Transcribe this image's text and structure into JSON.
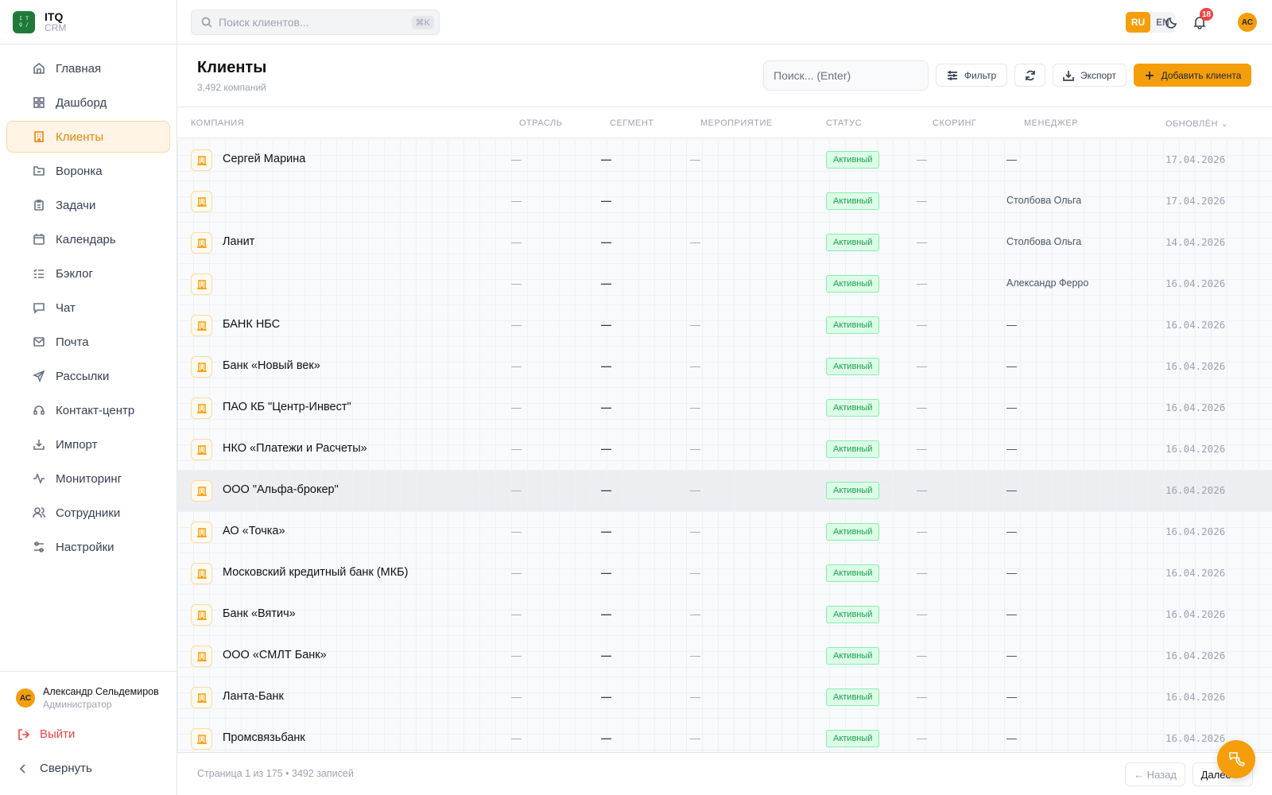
{
  "brand": {
    "name": "ITQ",
    "sub": "CRM",
    "logo_glyphs": [
      "I",
      "T",
      "Q",
      "/"
    ]
  },
  "sidebar": {
    "items": [
      {
        "label": "Главная",
        "icon": "home-icon"
      },
      {
        "label": "Дашборд",
        "icon": "dashboard-icon"
      },
      {
        "label": "Клиенты",
        "icon": "building-icon",
        "active": true
      },
      {
        "label": "Воронка",
        "icon": "funnel-icon"
      },
      {
        "label": "Задачи",
        "icon": "clipboard-icon"
      },
      {
        "label": "Календарь",
        "icon": "calendar-icon"
      },
      {
        "label": "Бэклог",
        "icon": "list-check-icon"
      },
      {
        "label": "Чат",
        "icon": "chat-icon"
      },
      {
        "label": "Почта",
        "icon": "mail-icon"
      },
      {
        "label": "Рассылки",
        "icon": "send-icon"
      },
      {
        "label": "Контакт-центр",
        "icon": "headset-icon"
      },
      {
        "label": "Импорт",
        "icon": "import-icon"
      },
      {
        "label": "Мониторинг",
        "icon": "activity-icon"
      },
      {
        "label": "Сотрудники",
        "icon": "users-icon"
      },
      {
        "label": "Настройки",
        "icon": "settings-sliders-icon"
      }
    ],
    "user": {
      "initials": "АС",
      "name": "Александр Сельдемиров",
      "role": "Администратор"
    },
    "logout_label": "Выйти",
    "collapse_label": "Свернуть"
  },
  "topbar": {
    "search_placeholder": "Поиск клиентов...",
    "search_shortcut": "⌘K",
    "lang_ru": "RU",
    "lang_en": "EN",
    "active_lang": "RU",
    "notifications_count": "18",
    "avatar_initials": "АС"
  },
  "page": {
    "title": "Клиенты",
    "subtitle": "3,492 компаний",
    "search_placeholder": "Поиск... (Enter)",
    "filter_label": "Фильтр",
    "export_label": "Экспорт",
    "add_label": "Добавить клиента"
  },
  "table": {
    "columns": [
      "КОМПАНИЯ",
      "ОТРАСЛЬ",
      "СЕГМЕНТ",
      "МЕРОПРИЯТИЕ",
      "СТАТУС",
      "СКОРИНГ",
      "МЕНЕДЖЕР",
      "ОБНОВЛЁН"
    ],
    "sort_indicator": "⌄",
    "rows": [
      {
        "company": "Сергей Марина",
        "industry": "—",
        "segment": "—",
        "event": "—",
        "status": "Активный",
        "scoring": "—",
        "manager": "—",
        "updated": "17.04.2026"
      },
      {
        "company": "",
        "industry": "—",
        "segment": "—",
        "event": "",
        "status": "Активный",
        "scoring": "—",
        "manager": "Столбова Ольга",
        "updated": "17.04.2026"
      },
      {
        "company": "Ланит",
        "industry": "—",
        "segment": "—",
        "event": "—",
        "status": "Активный",
        "scoring": "—",
        "manager": "Столбова Ольга",
        "updated": "14.04.2026"
      },
      {
        "company": "",
        "industry": "—",
        "segment": "—",
        "event": "",
        "status": "Активный",
        "scoring": "—",
        "manager": "Александр Ферро",
        "updated": "16.04.2026"
      },
      {
        "company": "БАНК НБС",
        "industry": "—",
        "segment": "—",
        "event": "—",
        "status": "Активный",
        "scoring": "—",
        "manager": "—",
        "updated": "16.04.2026"
      },
      {
        "company": "Банк «Новый век»",
        "industry": "—",
        "segment": "—",
        "event": "—",
        "status": "Активный",
        "scoring": "—",
        "manager": "—",
        "updated": "16.04.2026"
      },
      {
        "company": "ПАО КБ \"Центр-Инвест\"",
        "industry": "—",
        "segment": "—",
        "event": "—",
        "status": "Активный",
        "scoring": "—",
        "manager": "—",
        "updated": "16.04.2026"
      },
      {
        "company": "НКО «Платежи и Расчеты»",
        "industry": "—",
        "segment": "—",
        "event": "—",
        "status": "Активный",
        "scoring": "—",
        "manager": "—",
        "updated": "16.04.2026"
      },
      {
        "company": "ООО \"Альфа-брокер\"",
        "industry": "—",
        "segment": "—",
        "event": "—",
        "status": "Активный",
        "scoring": "—",
        "manager": "—",
        "updated": "16.04.2026",
        "hover": true
      },
      {
        "company": "АО «Точка»",
        "industry": "—",
        "segment": "—",
        "event": "—",
        "status": "Активный",
        "scoring": "—",
        "manager": "—",
        "updated": "16.04.2026"
      },
      {
        "company": "Московский кредитный банк (МКБ)",
        "industry": "—",
        "segment": "—",
        "event": "—",
        "status": "Активный",
        "scoring": "—",
        "manager": "—",
        "updated": "16.04.2026"
      },
      {
        "company": "Банк «Вятич»",
        "industry": "—",
        "segment": "—",
        "event": "—",
        "status": "Активный",
        "scoring": "—",
        "manager": "—",
        "updated": "16.04.2026"
      },
      {
        "company": "ООО «СМЛТ Банк»",
        "industry": "—",
        "segment": "—",
        "event": "—",
        "status": "Активный",
        "scoring": "—",
        "manager": "—",
        "updated": "16.04.2026"
      },
      {
        "company": "Ланта-Банк",
        "industry": "—",
        "segment": "—",
        "event": "—",
        "status": "Активный",
        "scoring": "—",
        "manager": "—",
        "updated": "16.04.2026"
      },
      {
        "company": "Промсвязьбанк",
        "industry": "—",
        "segment": "—",
        "event": "—",
        "status": "Активный",
        "scoring": "—",
        "manager": "—",
        "updated": "16.04.2026"
      }
    ]
  },
  "footer": {
    "page_info": "Страница 1 из 175 • 3492 записей",
    "prev_label": "← Назад",
    "next_label": "Далее →"
  },
  "colors": {
    "accent": "#f59e0b",
    "status_active": "#16a34a",
    "danger": "#ef4444",
    "brand_logo": "#1f7a3a"
  }
}
